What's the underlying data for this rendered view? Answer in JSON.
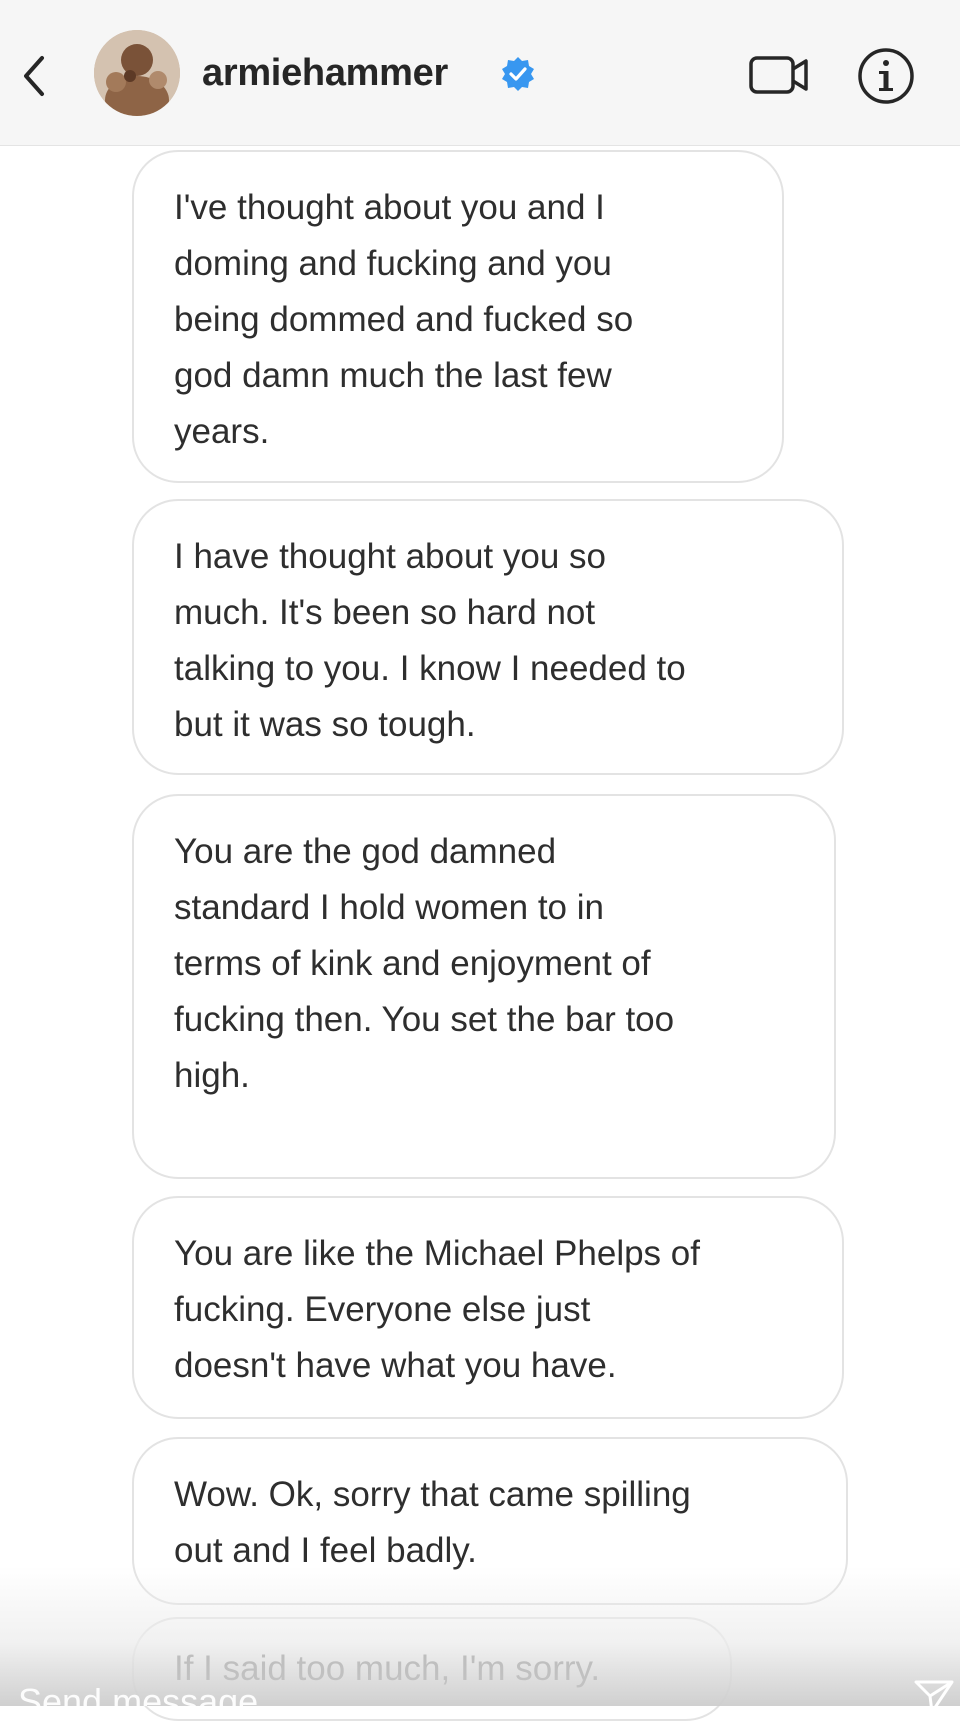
{
  "header": {
    "username": "armiehammer",
    "verified_color": "#3897f0",
    "icons": [
      "chevron-left-icon",
      "avatar",
      "verified-badge-icon",
      "video-camera-icon",
      "info-icon"
    ]
  },
  "messages": [
    "I've thought about you and I\ndoming and fucking and you\nbeing dommed and fucked so\ngod damn much the last few\nyears.",
    "I have thought about you so\nmuch. It's been so hard not\ntalking to you. I know I needed to\nbut it was so tough.",
    "You are the god damned\nstandard I hold women to in\nterms of kink and enjoyment of\nfucking then. You set the bar too\nhigh.",
    "You are like the Michael Phelps of\nfucking. Everyone else just\ndoesn't have what you have.",
    "Wow. Ok, sorry that came spilling\nout and I feel badly.",
    "If I said too much, I'm sorry."
  ],
  "composer": {
    "placeholder": "Send message",
    "send_icon": "send-icon"
  }
}
